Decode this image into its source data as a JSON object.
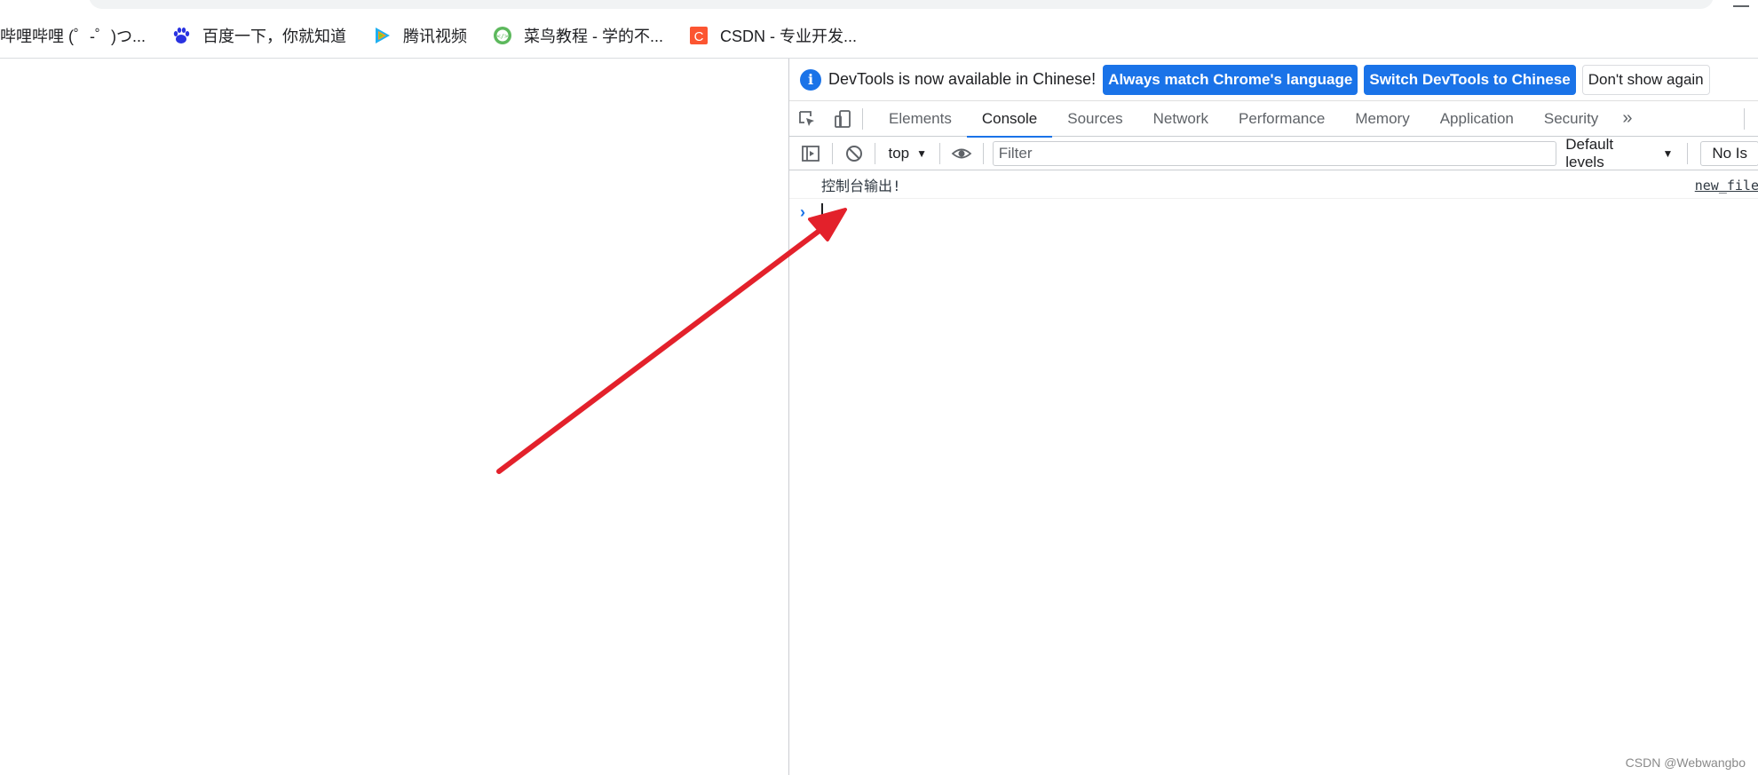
{
  "bookmarks": [
    {
      "label": "哔哩哔哩 (゜-゜)つ...",
      "icon": "bilibili-icon"
    },
    {
      "label": "百度一下，你就知道",
      "icon": "baidu-paw-icon"
    },
    {
      "label": "腾讯视频",
      "icon": "tencent-video-icon"
    },
    {
      "label": "菜鸟教程 - 学的不...",
      "icon": "runoob-icon"
    },
    {
      "label": "CSDN - 专业开发...",
      "icon": "csdn-icon"
    }
  ],
  "devtools": {
    "infobar": {
      "message": "DevTools is now available in Chinese!",
      "buttons": [
        "Always match Chrome's language",
        "Switch DevTools to Chinese",
        "Don't show again"
      ]
    },
    "tabs": [
      "Elements",
      "Console",
      "Sources",
      "Network",
      "Performance",
      "Memory",
      "Application",
      "Security"
    ],
    "active_tab": "Console",
    "more_tabs_label": "»",
    "console_toolbar": {
      "context": "top",
      "filter_placeholder": "Filter",
      "levels": "Default levels",
      "issues": "No Is"
    },
    "log": [
      {
        "message": "控制台输出!",
        "source": "new_file"
      }
    ]
  },
  "watermark": "CSDN @Webwangbo",
  "colors": {
    "accent": "#1a73e8",
    "annotation_arrow": "#e3212b"
  }
}
